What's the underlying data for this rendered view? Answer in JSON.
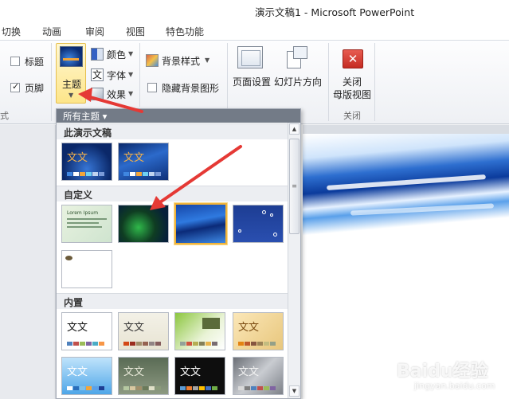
{
  "window": {
    "title": "演示文稿1 - Microsoft PowerPoint"
  },
  "tabs": [
    {
      "label": "切换"
    },
    {
      "label": "动画"
    },
    {
      "label": "审阅"
    },
    {
      "label": "视图"
    },
    {
      "label": "特色功能"
    }
  ],
  "ribbon": {
    "master_group": {
      "title_label": "标题",
      "title_checked": false,
      "footer_label": "页脚",
      "footer_checked": true,
      "group_label": "式"
    },
    "theme_group": {
      "theme_label": "主题",
      "colors_label": "颜色",
      "fonts_label": "字体",
      "effects_label": "效果"
    },
    "background_group": {
      "bg_styles_label": "背景样式",
      "hide_bg_label": "隐藏背景图形",
      "hide_bg_checked": false
    },
    "page_setup_group": {
      "page_setup_label": "页面设置",
      "orientation_label": "幻灯片方向"
    },
    "close_group": {
      "close_label_1": "关闭",
      "close_label_2": "母版视图",
      "group_label": "关闭"
    }
  },
  "gallery": {
    "header": "所有主题 ▾",
    "sections": {
      "this_presentation": "此演示文稿",
      "custom": "自定义",
      "builtin": "内置"
    },
    "thumb_text": "文文",
    "lorem_text": "Lorem Ipsum"
  },
  "colors": {
    "accent_red": "#e53935",
    "selection_gold": "#f2b43a",
    "gallery_header": "#737b87"
  },
  "watermark": {
    "logo": "Baidu经验",
    "url": "jingyan.baidu.com"
  }
}
